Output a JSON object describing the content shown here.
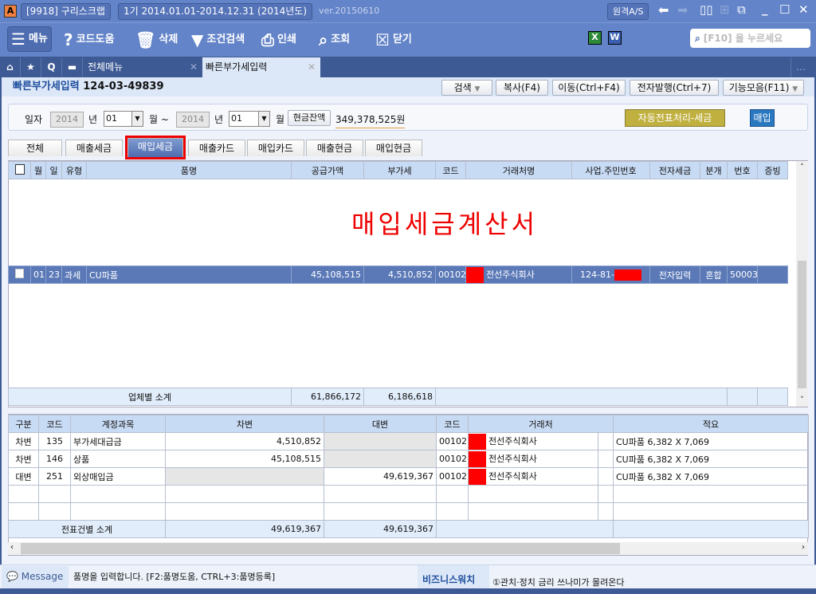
{
  "titlebar": {
    "company": "[9918] 구리스크랩",
    "period": "1기  2014.01.01-2014.12.31  (2014년도)",
    "version": "ver.20150610",
    "remote": "원격A/S"
  },
  "toolbar": {
    "menu": "메뉴",
    "code_help": "코드도움",
    "delete": "삭제",
    "filter": "조건검색",
    "print": "인쇄",
    "view": "조회",
    "close": "닫기",
    "search_placeholder": "[F10] 을 누르세요"
  },
  "tabs": {
    "all_menu": "전체메뉴",
    "current": "빠른부가세입력"
  },
  "page": {
    "title": "빠른부가세입력",
    "bizno": "124-03-49839",
    "buttons": {
      "search": "검색",
      "copy": "복사(F4)",
      "move": "이동(Ctrl+F4)",
      "einvoice": "전자발행(Ctrl+7)",
      "functions": "기능모음(F11)"
    }
  },
  "filter": {
    "date_label": "일자",
    "year_from": "2014",
    "year_label": "년",
    "month_from": "01",
    "month_label": "월 ~",
    "year_to": "2014",
    "month_to": "01",
    "month_label2": "월",
    "cash_label": "현금잔액",
    "cash_value": "349,378,525원",
    "auto_btn": "자동전표처리-세금",
    "purchase_btn": "매입"
  },
  "subtabs": [
    "전체",
    "매출세금",
    "매입세금",
    "매출카드",
    "매입카드",
    "매출현금",
    "매입현금"
  ],
  "grid1": {
    "headers": [
      "월",
      "일",
      "유형",
      "품명",
      "공급가액",
      "부가세",
      "코드",
      "거래처명",
      "사업.주민번호",
      "전자세금",
      "분개",
      "번호",
      "증빙"
    ],
    "watermark": "매입세금계산서",
    "row": {
      "month": "01",
      "day": "23",
      "type": "과세",
      "item": "CU파품",
      "supply": "45,108,515",
      "vat": "4,510,852",
      "code": "00102",
      "vendor": "전선주식회사",
      "bizno": "124-81-",
      "etax": "전자입력",
      "journal": "혼합",
      "no": "50003"
    },
    "subtotal": {
      "label": "업체별 소계",
      "supply": "61,866,172",
      "vat": "6,186,618"
    }
  },
  "grid2": {
    "headers": [
      "구분",
      "코드",
      "계정과목",
      "차변",
      "대변",
      "코드",
      "거래처",
      "적요"
    ],
    "rows": [
      {
        "type": "차변",
        "code": "135",
        "account": "부가세대급금",
        "debit": "4,510,852",
        "credit": "",
        "vcode": "00102",
        "vendor": "전선주식회사",
        "memo": "CU파품 6,382 X 7,069"
      },
      {
        "type": "차변",
        "code": "146",
        "account": "상품",
        "debit": "45,108,515",
        "credit": "",
        "vcode": "00102",
        "vendor": "전선주식회사",
        "memo": "CU파품 6,382 X 7,069"
      },
      {
        "type": "대변",
        "code": "251",
        "account": "외상매입금",
        "debit": "",
        "credit": "49,619,367",
        "vcode": "00102",
        "vendor": "전선주식회사",
        "memo": "CU파품 6,382 X 7,069"
      }
    ],
    "subtotal": {
      "label": "전표건별 소계",
      "debit": "49,619,367",
      "credit": "49,619,367"
    }
  },
  "status": {
    "message_label": "Message",
    "message": "품명을 입력합니다. [F2:품명도움, CTRL+3:품명등록]",
    "biz_label": "비즈니스워치",
    "news": "①관치·정치 금리 쓰나미가 몰려온다"
  }
}
